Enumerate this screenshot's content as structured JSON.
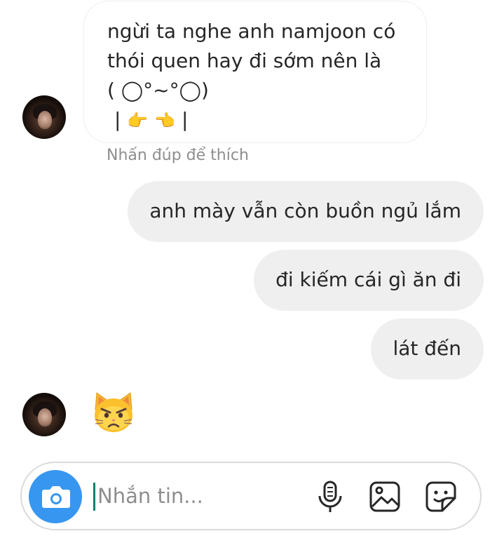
{
  "messages": [
    {
      "sender": "them",
      "lines": [
        "ngừi ta nghe anh namjoon có",
        "thói quen hay đi sớm nên là",
        "( ◯°~°◯)"
      ],
      "pointer_line": {
        "left": "|",
        "emoji_left": "👉",
        "emoji_right": "👈",
        "right": "|"
      },
      "status": "Nhấn đúp để thích"
    },
    {
      "sender": "me",
      "text": "anh mày vẫn còn buồn ngủ lắm"
    },
    {
      "sender": "me",
      "text": "đi kiếm cái gì ăn đi"
    },
    {
      "sender": "me",
      "text": "lát đến"
    },
    {
      "sender": "them",
      "emoji": "pouting-cat",
      "icon": "pouting-cat-icon"
    }
  ],
  "composer": {
    "placeholder": "Nhắn tin...",
    "icons": [
      "camera-icon",
      "microphone-icon",
      "gallery-icon",
      "sticker-icon"
    ]
  },
  "colors": {
    "accent": "#3797f0",
    "bubble_out": "#efefef",
    "bubble_in_border": "#efefef",
    "muted_text": "#8e8e8e",
    "text": "#262626",
    "caret": "#0f7f72"
  }
}
